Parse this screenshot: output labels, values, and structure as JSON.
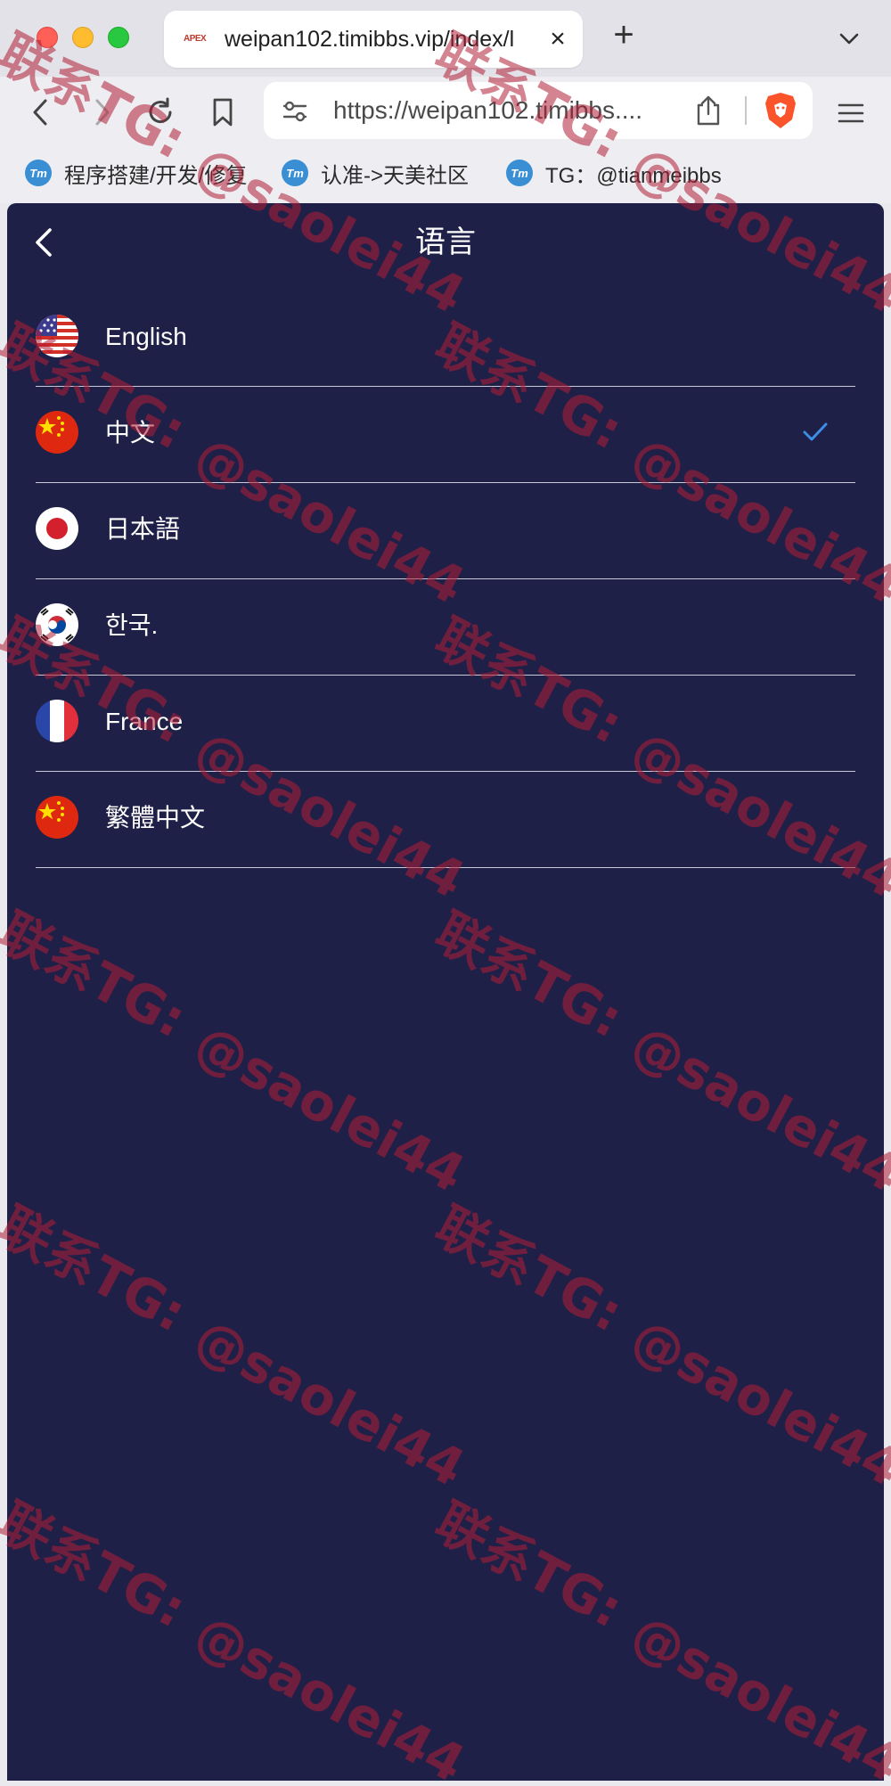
{
  "browser": {
    "tab_favicon_text": "APEX",
    "tab_title": "weipan102.timibbs.vip/index/l",
    "url": "https://weipan102.timibbs....",
    "bookmarks": [
      {
        "label": "程序搭建/开发/修复",
        "icon_text": "Tm"
      },
      {
        "label": "认准->天美社区",
        "icon_text": "Tm"
      },
      {
        "label": "TG：@tianmeibbs",
        "icon_text": "Tm"
      }
    ]
  },
  "page": {
    "title": "语言",
    "languages": [
      {
        "label": "English",
        "flag": "us-flag-icon",
        "selected": false
      },
      {
        "label": "中文",
        "flag": "cn-flag-icon",
        "selected": true
      },
      {
        "label": "日本語",
        "flag": "jp-flag-icon",
        "selected": false
      },
      {
        "label": "한국.",
        "flag": "kr-flag-icon",
        "selected": false
      },
      {
        "label": "France",
        "flag": "fr-flag-icon",
        "selected": false
      },
      {
        "label": "繁體中文",
        "flag": "cn-flag-icon",
        "selected": false
      }
    ]
  },
  "watermark": {
    "line1": "联系TG:",
    "line2": "@saolei44"
  },
  "colors": {
    "page_bg": "#1f2047",
    "check": "#3d8ee6",
    "watermark": "#b01e34"
  }
}
